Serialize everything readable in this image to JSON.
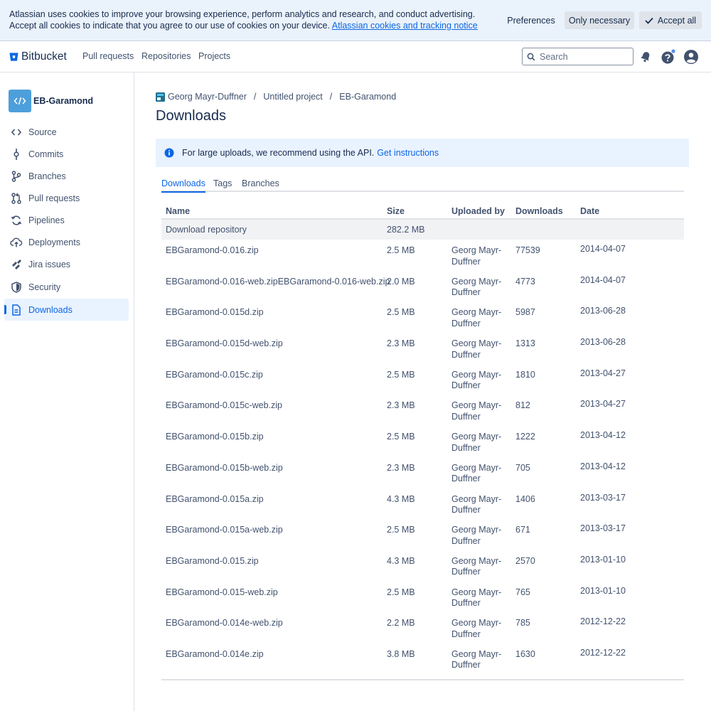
{
  "cookie_banner": {
    "text": "Atlassian uses cookies to improve your browsing experience, perform analytics and research, and conduct advertising. Accept all cookies to indicate that you agree to our use of cookies on your device.",
    "link": "Atlassian cookies and tracking notice",
    "preferences": "Preferences",
    "only_necessary": "Only necessary",
    "accept_all": "Accept all"
  },
  "topnav": {
    "logo": "Bitbucket",
    "items": [
      "Pull requests",
      "Repositories",
      "Projects"
    ],
    "search_placeholder": "Search"
  },
  "sidebar": {
    "repo_name": "EB-Garamond",
    "items": [
      {
        "label": "Source",
        "icon": "code-icon"
      },
      {
        "label": "Commits",
        "icon": "commit-icon"
      },
      {
        "label": "Branches",
        "icon": "branch-icon"
      },
      {
        "label": "Pull requests",
        "icon": "pull-request-icon"
      },
      {
        "label": "Pipelines",
        "icon": "pipelines-icon"
      },
      {
        "label": "Deployments",
        "icon": "cloud-upload-icon"
      },
      {
        "label": "Jira issues",
        "icon": "jira-icon"
      },
      {
        "label": "Security",
        "icon": "shield-icon"
      },
      {
        "label": "Downloads",
        "icon": "document-icon"
      }
    ]
  },
  "breadcrumb": [
    "Georg Mayr-Duffner",
    "Untitled project",
    "EB-Garamond"
  ],
  "page_title": "Downloads",
  "info": {
    "text": "For large uploads, we recommend using the API.",
    "link": "Get instructions"
  },
  "tabs": [
    "Downloads",
    "Tags",
    "Branches"
  ],
  "table": {
    "headers": [
      "Name",
      "Size",
      "Uploaded by",
      "Downloads",
      "Date"
    ],
    "download_repo": {
      "name": "Download repository",
      "size": "282.2 MB"
    },
    "rows": [
      {
        "name": "EBGaramond-0.016.zip",
        "size": "2.5 MB",
        "uploader": "Georg Mayr-Duffner",
        "downloads": "77539",
        "date": "2014-04-07"
      },
      {
        "name": "EBGaramond-0.016-web.zipEBGaramond-0.016-web.zip",
        "size": "2.0 MB",
        "uploader": "Georg Mayr-Duffner",
        "downloads": "4773",
        "date": "2014-04-07"
      },
      {
        "name": "EBGaramond-0.015d.zip",
        "size": "2.5 MB",
        "uploader": "Georg Mayr-Duffner",
        "downloads": "5987",
        "date": "2013-06-28"
      },
      {
        "name": "EBGaramond-0.015d-web.zip",
        "size": "2.3 MB",
        "uploader": "Georg Mayr-Duffner",
        "downloads": "1313",
        "date": "2013-06-28"
      },
      {
        "name": "EBGaramond-0.015c.zip",
        "size": "2.5 MB",
        "uploader": "Georg Mayr-Duffner",
        "downloads": "1810",
        "date": "2013-04-27"
      },
      {
        "name": "EBGaramond-0.015c-web.zip",
        "size": "2.3 MB",
        "uploader": "Georg Mayr-Duffner",
        "downloads": "812",
        "date": "2013-04-27"
      },
      {
        "name": "EBGaramond-0.015b.zip",
        "size": "2.5 MB",
        "uploader": "Georg Mayr-Duffner",
        "downloads": "1222",
        "date": "2013-04-12"
      },
      {
        "name": "EBGaramond-0.015b-web.zip",
        "size": "2.3 MB",
        "uploader": "Georg Mayr-Duffner",
        "downloads": "705",
        "date": "2013-04-12"
      },
      {
        "name": "EBGaramond-0.015a.zip",
        "size": "4.3 MB",
        "uploader": "Georg Mayr-Duffner",
        "downloads": "1406",
        "date": "2013-03-17"
      },
      {
        "name": "EBGaramond-0.015a-web.zip",
        "size": "2.5 MB",
        "uploader": "Georg Mayr-Duffner",
        "downloads": "671",
        "date": "2013-03-17"
      },
      {
        "name": "EBGaramond-0.015.zip",
        "size": "4.3 MB",
        "uploader": "Georg Mayr-Duffner",
        "downloads": "2570",
        "date": "2013-01-10"
      },
      {
        "name": "EBGaramond-0.015-web.zip",
        "size": "2.5 MB",
        "uploader": "Georg Mayr-Duffner",
        "downloads": "765",
        "date": "2013-01-10"
      },
      {
        "name": "EBGaramond-0.014e-web.zip",
        "size": "2.2 MB",
        "uploader": "Georg Mayr-Duffner",
        "downloads": "785",
        "date": "2012-12-22"
      },
      {
        "name": "EBGaramond-0.014e.zip",
        "size": "3.8 MB",
        "uploader": "Georg Mayr-Duffner",
        "downloads": "1630",
        "date": "2012-12-22"
      }
    ]
  },
  "colors": {
    "accent": "#0c66e4",
    "banner_bg": "#eaf2fb",
    "repo_avatar": "#4d9fdb",
    "notification_dot": "#5b8def"
  }
}
